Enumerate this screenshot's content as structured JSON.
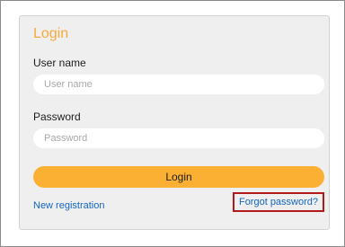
{
  "login_form": {
    "title": "Login",
    "username": {
      "label": "User name",
      "placeholder": "User name",
      "value": ""
    },
    "password": {
      "label": "Password",
      "placeholder": "Password",
      "value": ""
    },
    "login_button": "Login",
    "new_registration_link": "New registration",
    "forgot_password_link": "Forgot password?"
  },
  "colors": {
    "title": "#f7a93a",
    "button": "#fbb034",
    "link": "#1565c0",
    "highlight_border": "#b11a1a",
    "panel_background": "#efefef"
  }
}
